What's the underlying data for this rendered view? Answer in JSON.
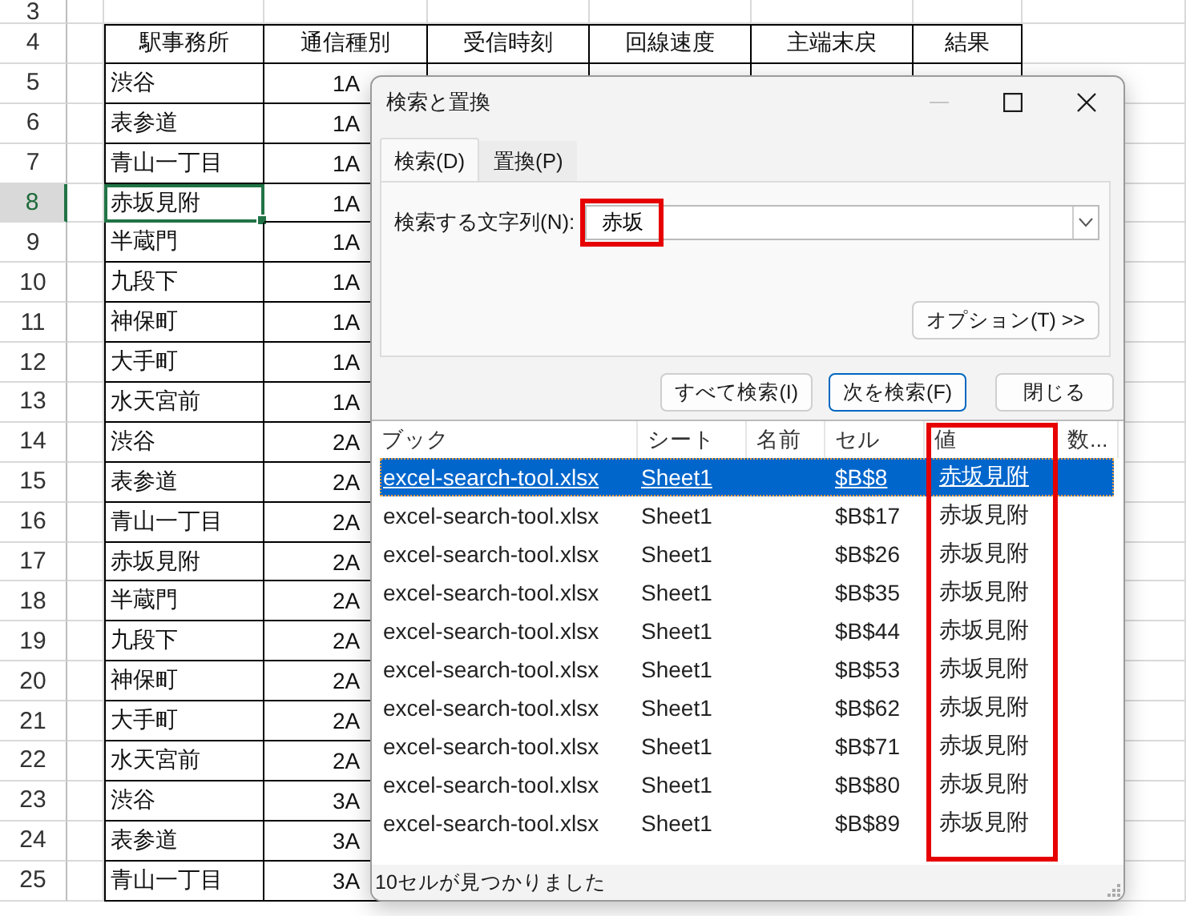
{
  "sheet": {
    "header_row": "4",
    "headers": [
      "駅事務所",
      "通信種別",
      "受信時刻",
      "回線速度",
      "主端末戻",
      "結果"
    ],
    "rows": [
      {
        "number": "3",
        "selected": false
      },
      {
        "number": "5",
        "selected": false,
        "cells": [
          "渋谷",
          "1A"
        ]
      },
      {
        "number": "6",
        "selected": false,
        "cells": [
          "表参道",
          "1A"
        ]
      },
      {
        "number": "7",
        "selected": false,
        "cells": [
          "青山一丁目",
          "1A"
        ]
      },
      {
        "number": "8",
        "selected": true,
        "cells": [
          "赤坂見附",
          "1A"
        ]
      },
      {
        "number": "9",
        "selected": false,
        "cells": [
          "半蔵門",
          "1A"
        ]
      },
      {
        "number": "10",
        "selected": false,
        "cells": [
          "九段下",
          "1A"
        ]
      },
      {
        "number": "11",
        "selected": false,
        "cells": [
          "神保町",
          "1A"
        ]
      },
      {
        "number": "12",
        "selected": false,
        "cells": [
          "大手町",
          "1A"
        ]
      },
      {
        "number": "13",
        "selected": false,
        "cells": [
          "水天宮前",
          "1A"
        ]
      },
      {
        "number": "14",
        "selected": false,
        "cells": [
          "渋谷",
          "2A"
        ]
      },
      {
        "number": "15",
        "selected": false,
        "cells": [
          "表参道",
          "2A"
        ]
      },
      {
        "number": "16",
        "selected": false,
        "cells": [
          "青山一丁目",
          "2A"
        ]
      },
      {
        "number": "17",
        "selected": false,
        "cells": [
          "赤坂見附",
          "2A"
        ]
      },
      {
        "number": "18",
        "selected": false,
        "cells": [
          "半蔵門",
          "2A"
        ]
      },
      {
        "number": "19",
        "selected": false,
        "cells": [
          "九段下",
          "2A"
        ]
      },
      {
        "number": "20",
        "selected": false,
        "cells": [
          "神保町",
          "2A"
        ]
      },
      {
        "number": "21",
        "selected": false,
        "cells": [
          "大手町",
          "2A"
        ]
      },
      {
        "number": "22",
        "selected": false,
        "cells": [
          "水天宮前",
          "2A"
        ]
      },
      {
        "number": "23",
        "selected": false,
        "cells": [
          "渋谷",
          "3A"
        ]
      },
      {
        "number": "24",
        "selected": false,
        "cells": [
          "表参道",
          "3A"
        ]
      },
      {
        "number": "25",
        "selected": false,
        "cells": [
          "青山一丁目",
          "3A"
        ]
      }
    ]
  },
  "dialog": {
    "title": "検索と置換",
    "window_buttons": [
      {
        "kind": "minimize",
        "disabled": true
      },
      {
        "kind": "maximize",
        "disabled": false
      },
      {
        "kind": "close",
        "disabled": false
      }
    ],
    "tabs": [
      {
        "label": "検索(D)",
        "selected": true
      },
      {
        "label": "置換(P)",
        "selected": false
      }
    ],
    "find_field": {
      "label": "検索する文字列(N):",
      "value": "赤坂",
      "highlighted": true
    },
    "options_button": "オプション(T) >>",
    "buttons": [
      {
        "label": "すべて検索(I)",
        "default": false
      },
      {
        "label": "次を検索(F)",
        "default": true
      },
      {
        "label": "閉じる",
        "default": false
      }
    ],
    "results": {
      "columns": [
        {
          "label": "ブック",
          "highlighted": false
        },
        {
          "label": "シート",
          "highlighted": false
        },
        {
          "label": "名前",
          "highlighted": false
        },
        {
          "label": "セル",
          "highlighted": false
        },
        {
          "label": "値",
          "highlighted": true
        },
        {
          "label": "数...",
          "highlighted": false
        }
      ],
      "rows": [
        {
          "book": "excel-search-tool.xlsx",
          "sheet": "Sheet1",
          "cell": "$B$8",
          "value": "赤坂見附",
          "selected": true
        },
        {
          "book": "excel-search-tool.xlsx",
          "sheet": "Sheet1",
          "cell": "$B$17",
          "value": "赤坂見附",
          "selected": false
        },
        {
          "book": "excel-search-tool.xlsx",
          "sheet": "Sheet1",
          "cell": "$B$26",
          "value": "赤坂見附",
          "selected": false
        },
        {
          "book": "excel-search-tool.xlsx",
          "sheet": "Sheet1",
          "cell": "$B$35",
          "value": "赤坂見附",
          "selected": false
        },
        {
          "book": "excel-search-tool.xlsx",
          "sheet": "Sheet1",
          "cell": "$B$44",
          "value": "赤坂見附",
          "selected": false
        },
        {
          "book": "excel-search-tool.xlsx",
          "sheet": "Sheet1",
          "cell": "$B$53",
          "value": "赤坂見附",
          "selected": false
        },
        {
          "book": "excel-search-tool.xlsx",
          "sheet": "Sheet1",
          "cell": "$B$62",
          "value": "赤坂見附",
          "selected": false
        },
        {
          "book": "excel-search-tool.xlsx",
          "sheet": "Sheet1",
          "cell": "$B$71",
          "value": "赤坂見附",
          "selected": false
        },
        {
          "book": "excel-search-tool.xlsx",
          "sheet": "Sheet1",
          "cell": "$B$80",
          "value": "赤坂見附",
          "selected": false
        },
        {
          "book": "excel-search-tool.xlsx",
          "sheet": "Sheet1",
          "cell": "$B$89",
          "value": "赤坂見附",
          "selected": false
        }
      ]
    },
    "status": "10セルが見つかりました"
  }
}
